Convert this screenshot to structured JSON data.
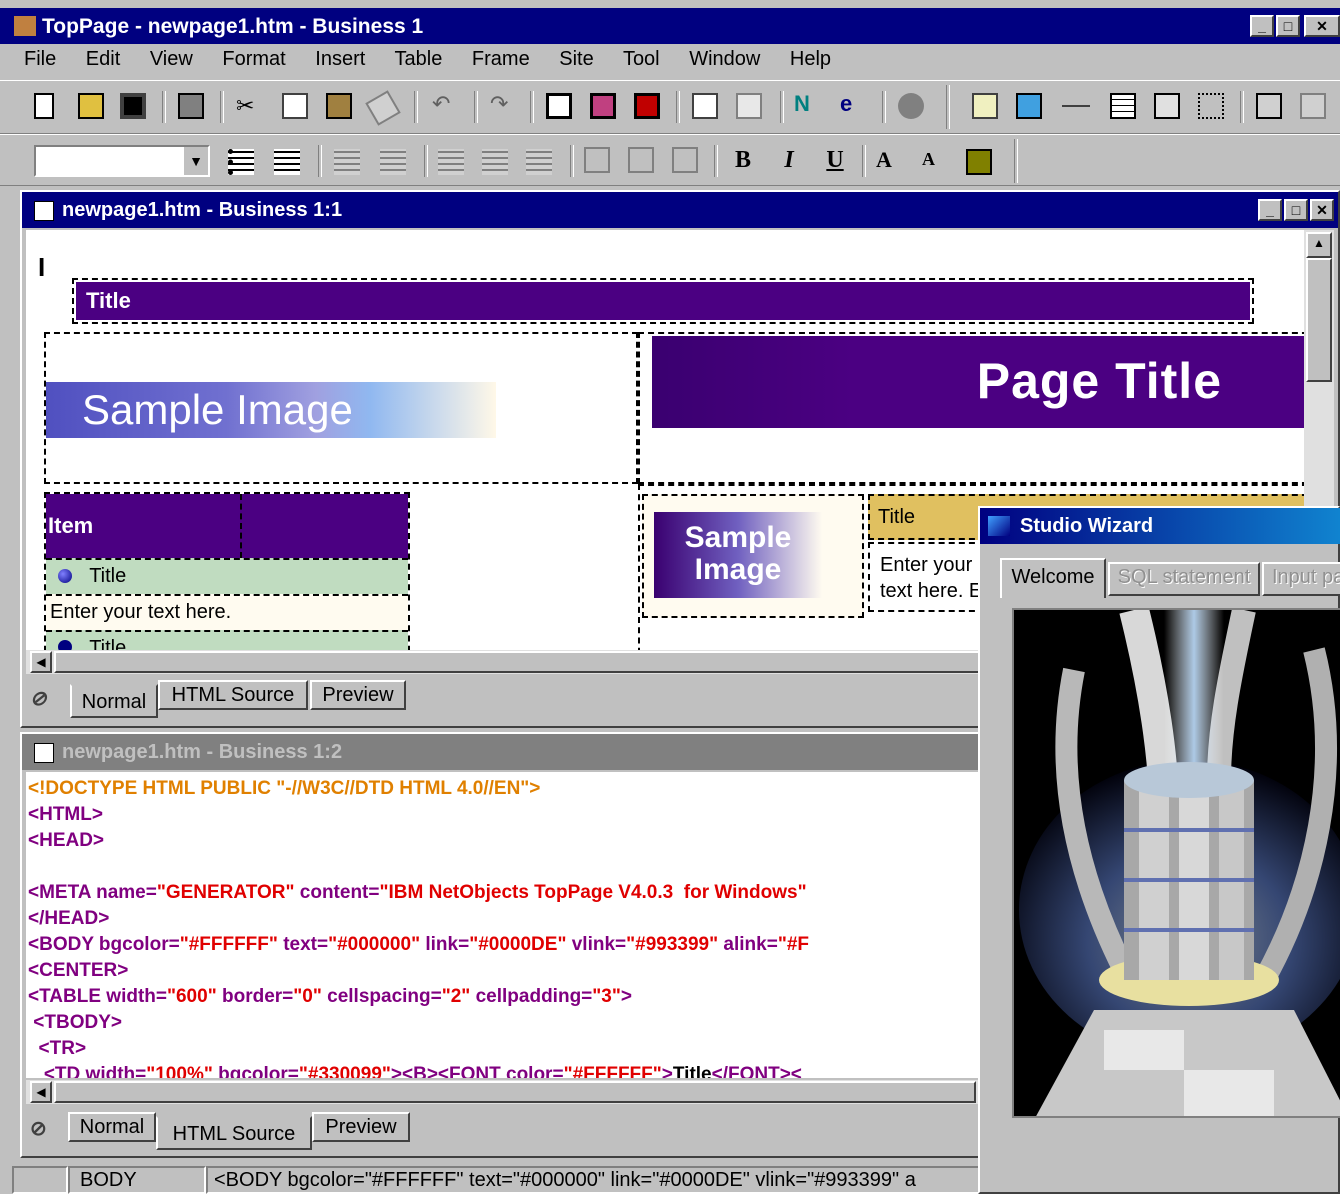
{
  "app": {
    "title": "TopPage - newpage1.htm - Business 1",
    "menu": [
      "File",
      "Edit",
      "View",
      "Format",
      "Insert",
      "Table",
      "Frame",
      "Site",
      "Tool",
      "Window",
      "Help"
    ],
    "font_size_select": ""
  },
  "format_toolbar": {
    "bold": "B",
    "italic": "I",
    "underline": "U"
  },
  "editor1": {
    "title": "newpage1.htm - Business 1:1",
    "cursor": "I",
    "title_bar_text": "Title",
    "sample_image": "Sample Image",
    "page_title": "Page Title",
    "item_header": "Item",
    "row_title": "Title",
    "row_text": "Enter your text here.",
    "row_title_cut": "Title",
    "small_sample_image": "Sample Image",
    "right_title": "Title",
    "right_text_1": "Enter your",
    "right_text_2": "text here. E",
    "tabs": [
      "Normal",
      "HTML Source",
      "Preview"
    ]
  },
  "editor2": {
    "title": "newpage1.htm - Business 1:2",
    "tabs": [
      "Normal",
      "HTML Source",
      "Preview"
    ]
  },
  "status": {
    "tag": "BODY",
    "text": "<BODY bgcolor=\"#FFFFFF\" text=\"#000000\" link=\"#0000DE\" vlink=\"#993399\" a"
  },
  "wizard": {
    "title": "Studio Wizard",
    "tabs": [
      "Welcome",
      "SQL statement",
      "Input pa"
    ]
  },
  "colors": {
    "title_blue": "#000080",
    "purple": "#4b0082",
    "green_row": "#c0dcc0",
    "cream": "#fffbf0"
  }
}
